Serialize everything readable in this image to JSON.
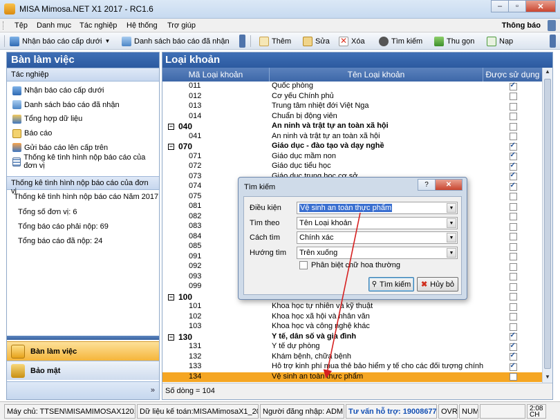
{
  "window": {
    "title": "MISA Mimosa.NET X1 2017 - RC1.6",
    "minimize": "–",
    "maximize": "▫",
    "close": "✕"
  },
  "menu": {
    "items": [
      "Tệp",
      "Danh mục",
      "Tác nghiệp",
      "Hệ thống",
      "Trợ giúp"
    ],
    "notice": "Thông báo"
  },
  "toolbar": {
    "receive": "Nhận báo cáo cấp dưới",
    "received_list": "Danh sách báo cáo đã nhận",
    "add": "Thêm",
    "edit": "Sửa",
    "delete": "Xóa",
    "search": "Tìm kiếm",
    "collapse": "Thu gọn",
    "reload": "Nạp"
  },
  "sidebar": {
    "title": "Bàn làm việc",
    "section_tasks": "Tác nghiệp",
    "tasks": [
      "Nhận báo cáo cấp dưới",
      "Danh sách báo cáo đã nhận",
      "Tổng hợp dữ liệu",
      "Báo cáo",
      "Gửi báo cáo lên cấp trên",
      "Thống kê tình hình nộp báo cáo của đơn vị"
    ],
    "section_stats": "Thống kê tình hình nộp báo cáo của đơn vị",
    "stats_title": "Thống kê tình hình nộp báo cáo Năm 2017",
    "stats": [
      "Tổng số đơn vị: 6",
      "Tổng báo cáo phải nộp: 69",
      "Tổng báo cáo đã nộp: 24"
    ],
    "nav_workspace": "Bàn làm việc",
    "nav_security": "Bảo mật",
    "more": "»"
  },
  "main": {
    "title": "Loại khoản",
    "columns": [
      "Mã Loại khoản",
      "Tên Loại khoản",
      "Được sử dụng"
    ],
    "rows": [
      {
        "code": "011",
        "name": "Quốc phòng",
        "used": true,
        "group": false
      },
      {
        "code": "012",
        "name": "Cơ yếu Chính phủ",
        "used": false,
        "group": false
      },
      {
        "code": "013",
        "name": "Trung tâm nhiệt đới Việt Nga",
        "used": false,
        "group": false
      },
      {
        "code": "014",
        "name": "Chuẩn bị động viên",
        "used": false,
        "group": false
      },
      {
        "code": "040",
        "name": "An ninh và trật tự an toàn xã hội",
        "used": false,
        "group": true
      },
      {
        "code": "041",
        "name": "An ninh và trật tự an toàn xã hội",
        "used": false,
        "group": false
      },
      {
        "code": "070",
        "name": "Giáo dục - đào tạo và dạy nghề",
        "used": true,
        "group": true
      },
      {
        "code": "071",
        "name": "Giáo dục mầm non",
        "used": true,
        "group": false
      },
      {
        "code": "072",
        "name": "Giáo dục tiểu học",
        "used": true,
        "group": false
      },
      {
        "code": "073",
        "name": "Giáo dục trung học cơ sở",
        "used": true,
        "group": false
      },
      {
        "code": "074",
        "name": "",
        "used": true,
        "group": false
      },
      {
        "code": "075",
        "name": "",
        "used": false,
        "group": false
      },
      {
        "code": "081",
        "name": "",
        "used": false,
        "group": false
      },
      {
        "code": "082",
        "name": "",
        "used": false,
        "group": false
      },
      {
        "code": "083",
        "name": "",
        "used": false,
        "group": false
      },
      {
        "code": "084",
        "name": "",
        "used": false,
        "group": false
      },
      {
        "code": "085",
        "name": "",
        "used": false,
        "group": false
      },
      {
        "code": "091",
        "name": "",
        "used": false,
        "group": false
      },
      {
        "code": "092",
        "name": "",
        "used": false,
        "group": false
      },
      {
        "code": "093",
        "name": "",
        "used": false,
        "group": false
      },
      {
        "code": "099",
        "name": "",
        "used": false,
        "group": false
      },
      {
        "code": "100",
        "name": "",
        "used": false,
        "group": true
      },
      {
        "code": "101",
        "name": "Khoa học tự nhiên và kỹ thuật",
        "used": false,
        "group": false
      },
      {
        "code": "102",
        "name": "Khoa học xã hội và nhân văn",
        "used": false,
        "group": false
      },
      {
        "code": "103",
        "name": "Khoa học và công nghệ khác",
        "used": false,
        "group": false
      },
      {
        "code": "130",
        "name": "Y tế, dân số và gia đình",
        "used": true,
        "group": true
      },
      {
        "code": "131",
        "name": "Y tế dự phòng",
        "used": true,
        "group": false
      },
      {
        "code": "132",
        "name": "Khám bệnh, chữa bệnh",
        "used": true,
        "group": false
      },
      {
        "code": "133",
        "name": "Hỗ trợ kinh phí mua thẻ bảo hiểm y tế cho các đối tượng chính...",
        "used": true,
        "group": false
      },
      {
        "code": "134",
        "name": "Vệ sinh an toàn thực phẩm",
        "used": false,
        "group": false,
        "selected": true
      }
    ],
    "row_count": "Số dòng = 104"
  },
  "dialog": {
    "title": "Tìm kiếm",
    "help": "?",
    "close": "✕",
    "condition_label": "Điều kiện",
    "condition_value": "Vệ sinh an toàn thực phẩm",
    "field_label": "Tìm theo",
    "field_value": "Tên Loại khoản",
    "method_label": "Cách tìm",
    "method_value": "Chính xác",
    "direction_label": "Hướng tìm",
    "direction_value": "Trên xuống",
    "case_label": "Phân biệt chữ hoa thường",
    "search_button": "Tìm kiếm",
    "cancel_button": "Hủy bỏ"
  },
  "status": {
    "server": "Máy chủ: TTSEN\\MISAMIMOSAX12017",
    "database": "Dữ liệu kế toán:MISAMimosaX1_2017",
    "user": "Người đăng nhập: ADMIN",
    "support": "Tư vấn hỗ trợ: 19008677",
    "ovr": "OVR",
    "num": "NUM",
    "time": "2:08",
    "period": "CH"
  },
  "colors": {
    "header_blue": "#2c5aa0",
    "selected_row": "#f5a623",
    "support_text": "#1450b4"
  }
}
